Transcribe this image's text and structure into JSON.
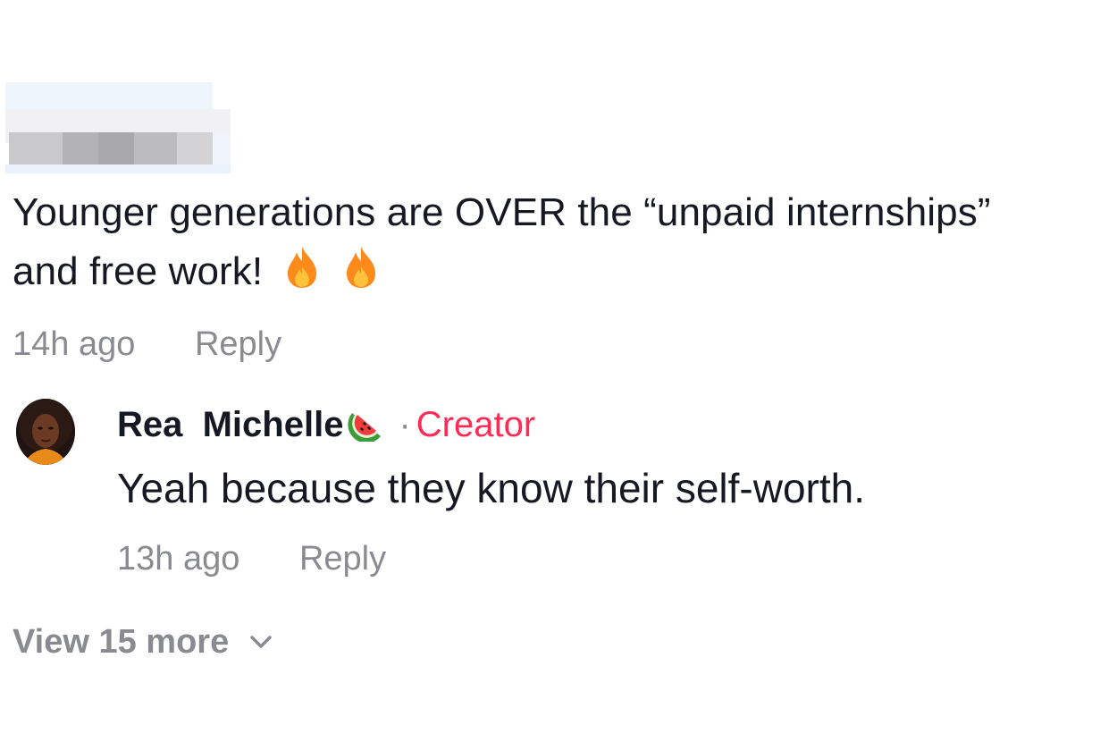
{
  "comment": {
    "author_label": "",
    "text": "Younger generations are OVER the “unpaid internships” and free work!",
    "emoji": [
      "fire",
      "fire"
    ],
    "timestamp": "14h ago",
    "reply_label": "Reply"
  },
  "reply": {
    "author": "Rea  Michelle",
    "author_emoji": "watermelon",
    "separator": "·",
    "badge": "Creator",
    "text": "Yeah because they know their self-worth.",
    "timestamp": "13h ago",
    "reply_label": "Reply"
  },
  "view_more": {
    "label": "View 15 more"
  },
  "colors": {
    "text": "#161823",
    "muted": "#8a8b91",
    "creator": "#fe2c55",
    "fire": "#ff9a1f"
  }
}
